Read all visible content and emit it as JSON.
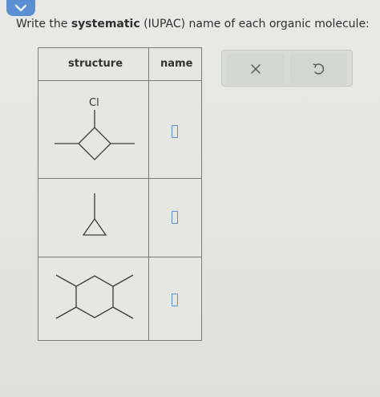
{
  "header": {
    "collapse_icon": "chevron-down-icon"
  },
  "prompt": {
    "prefix": "Write the ",
    "bold": "systematic",
    "suffix": " (IUPAC) name of each organic molecule:"
  },
  "table": {
    "headers": {
      "structure": "structure",
      "name": "name"
    },
    "rows": [
      {
        "substituent_label": "Cl",
        "answer": ""
      },
      {
        "answer": ""
      },
      {
        "answer": ""
      }
    ]
  },
  "actions": {
    "clear_icon": "x-icon",
    "undo_icon": "undo-icon"
  },
  "colors": {
    "accent": "#5b8fd1",
    "background": "#e6e6e3",
    "border": "#7a7a7a",
    "text": "#2f2f2f"
  }
}
